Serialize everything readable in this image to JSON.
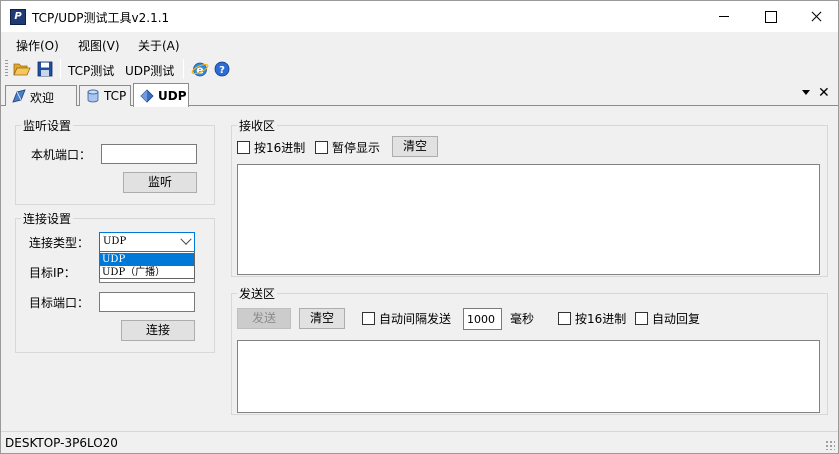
{
  "window": {
    "title": "TCP/UDP测试工具v2.1.1"
  },
  "menu": {
    "items": [
      "操作(O)",
      "视图(V)",
      "关于(A)"
    ]
  },
  "toolbar": {
    "tcp_label": "TCP测试",
    "udp_label": "UDP测试"
  },
  "tabs": [
    {
      "label": "欢迎",
      "icon": "welcome-icon"
    },
    {
      "label": "TCP",
      "icon": "database-icon"
    },
    {
      "label": "UDP",
      "icon": "diamond-icon",
      "active": true
    }
  ],
  "listen": {
    "title": "监听设置",
    "port_label": "本机端口：",
    "port_value": "",
    "button": "监听"
  },
  "connect": {
    "title": "连接设置",
    "type_label": "连接类型：",
    "type_value": "UDP",
    "type_options": [
      "UDP",
      "UDP（广播）"
    ],
    "ip_label": "目标IP：",
    "ip_value": "",
    "port_label": "目标端口：",
    "port_value": "",
    "button": "连接"
  },
  "receive": {
    "title": "接收区",
    "hex_label": "按16进制",
    "pause_label": "暂停显示",
    "clear_button": "清空",
    "content": ""
  },
  "send": {
    "title": "发送区",
    "send_button": "发送",
    "clear_button": "清空",
    "auto_label": "自动间隔发送",
    "interval_value": "1000",
    "unit_label": "毫秒",
    "hex_label": "按16进制",
    "reply_label": "自动回复",
    "content": ""
  },
  "status": {
    "text": "DESKTOP-3P6LO20"
  },
  "colors": {
    "accent": "#0078d7",
    "window_bg": "#f0f0f0"
  }
}
